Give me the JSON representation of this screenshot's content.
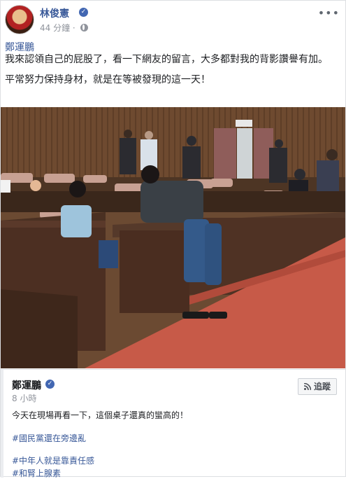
{
  "post": {
    "author": "林俊憲",
    "time": "44 分鐘",
    "shared_from": "鄭運鵬",
    "paragraph1": "我來認領自己的屁股了，看一下網友的留言，大多都對我的背影讚譽有加。",
    "paragraph2": "平常努力保持身材，就是在等被發現的這一天！"
  },
  "embed": {
    "author": "鄭運鵬",
    "time": "8 小時",
    "follow_label": "追蹤",
    "text": "今天在現場再看一下，這個桌子還真的蠻高的！",
    "tags": [
      "#國民黨還在旁邊亂",
      "#中年人就是靠責任感",
      "#和腎上腺素"
    ]
  },
  "icons": {
    "verified": "verified-badge-icon",
    "privacy": "globe-icon",
    "more": "more-options-icon",
    "follow": "rss-icon"
  },
  "colors": {
    "link": "#385898",
    "accent": "#4267b2",
    "floor": "#c75a48",
    "wood": "#6b4a32"
  }
}
